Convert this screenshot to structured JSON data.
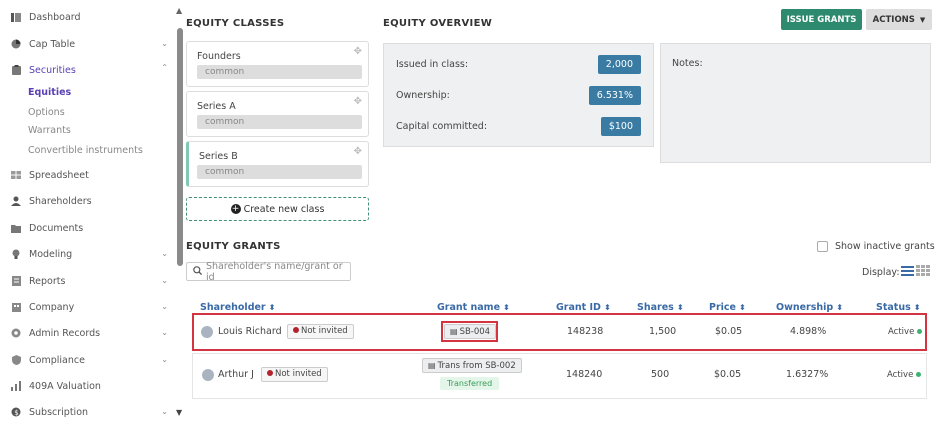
{
  "sidebar": {
    "items": [
      {
        "label": "Dashboard",
        "icon": "dashboard-icon",
        "chevron": false
      },
      {
        "label": "Cap Table",
        "icon": "pie-chart-icon",
        "chevron": true
      },
      {
        "label": "Securities",
        "icon": "clipboard-icon",
        "chevron": true,
        "active": true
      },
      {
        "label": "Spreadsheet",
        "icon": "spreadsheet-icon",
        "chevron": false
      },
      {
        "label": "Shareholders",
        "icon": "user-icon",
        "chevron": false
      },
      {
        "label": "Documents",
        "icon": "folder-icon",
        "chevron": false
      },
      {
        "label": "Modeling",
        "icon": "lightbulb-icon",
        "chevron": true
      },
      {
        "label": "Reports",
        "icon": "report-icon",
        "chevron": true
      },
      {
        "label": "Company",
        "icon": "building-icon",
        "chevron": true
      },
      {
        "label": "Admin Records",
        "icon": "admin-icon",
        "chevron": true
      },
      {
        "label": "Compliance",
        "icon": "shield-icon",
        "chevron": true
      },
      {
        "label": "409A Valuation",
        "icon": "valuation-icon",
        "chevron": false
      },
      {
        "label": "Subscription",
        "icon": "subscription-icon",
        "chevron": true
      }
    ],
    "sub_items": [
      "Equities",
      "Options",
      "Warrants",
      "Convertible instruments"
    ]
  },
  "equity_classes": {
    "title": "EQUITY CLASSES",
    "classes": [
      {
        "name": "Founders",
        "tag": "common"
      },
      {
        "name": "Series A",
        "tag": "common"
      },
      {
        "name": "Series B",
        "tag": "common"
      }
    ],
    "create_label": "Create new class"
  },
  "overview": {
    "title": "EQUITY OVERVIEW",
    "rows": [
      {
        "label": "Issued in class:",
        "value": "2,000"
      },
      {
        "label": "Ownership:",
        "value": "6.531%"
      },
      {
        "label": "Capital committed:",
        "value": "$100"
      }
    ],
    "notes_label": "Notes:"
  },
  "actions": {
    "issue_label": "ISSUE GRANTS",
    "actions_label": "ACTIONS"
  },
  "grants": {
    "title": "EQUITY GRANTS",
    "show_inactive_label": "Show inactive grants",
    "search_placeholder": "Shareholder's name/grant or id",
    "display_label": "Display:",
    "columns": [
      "Shareholder",
      "Grant name",
      "Grant ID",
      "Shares",
      "Price",
      "Ownership",
      "Status"
    ],
    "rows": [
      {
        "shareholder": "Louis Richard",
        "invite": "Not invited",
        "grant_name": "SB-004",
        "grant_id": "148238",
        "shares": "1,500",
        "price": "$0.05",
        "ownership": "4.898%",
        "status": "Active"
      },
      {
        "shareholder": "Arthur J",
        "invite": "Not invited",
        "grant_name": "Trans from SB-002",
        "transferred": "Transferred",
        "grant_id": "148240",
        "shares": "500",
        "price": "$0.05",
        "ownership": "1.6327%",
        "status": "Active"
      }
    ]
  }
}
